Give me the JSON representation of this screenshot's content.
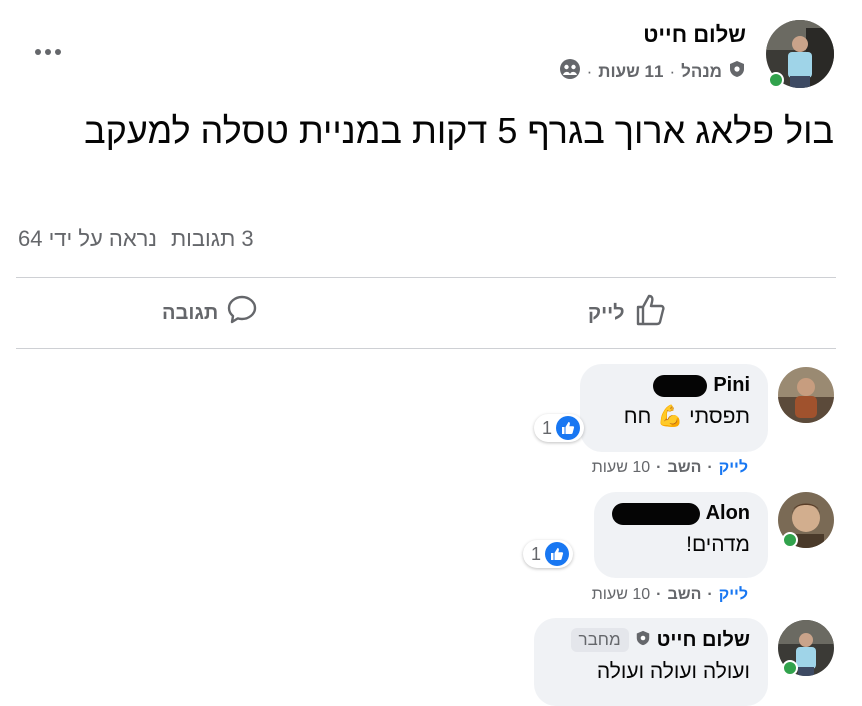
{
  "post": {
    "author": "שלום חייט",
    "role": "מנהל",
    "time": "11 שעות",
    "dot": "·",
    "body": "בול פלאג ארוך בגרף 5 דקות במניית טסלה למעקב",
    "comments_count": "3 תגובות",
    "seen_by": "נראה על ידי 64"
  },
  "actions": {
    "like": "לייק",
    "comment": "תגובה"
  },
  "comments": [
    {
      "name": "Pini",
      "text": "תפסתי 💪 חח",
      "reactions": "1",
      "like": "לייק",
      "reply": "השב",
      "time": "10 שעות"
    },
    {
      "name": "Alon",
      "text": "מדהים!",
      "reactions": "1",
      "like": "לייק",
      "reply": "השב",
      "time": "10 שעות"
    },
    {
      "name": "שלום חייט",
      "badge": "מחבר",
      "text": "ועולה ועולה ועולה"
    }
  ],
  "icons": [
    "more-horizontal-icon",
    "admin-shield-icon",
    "group-privacy-icon",
    "like-thumb-icon",
    "comment-bubble-icon",
    "like-reaction-icon"
  ],
  "colors": {
    "brand": "#1877f2",
    "online": "#31a24c",
    "muted": "#65676b",
    "bubble": "#f0f2f5"
  }
}
